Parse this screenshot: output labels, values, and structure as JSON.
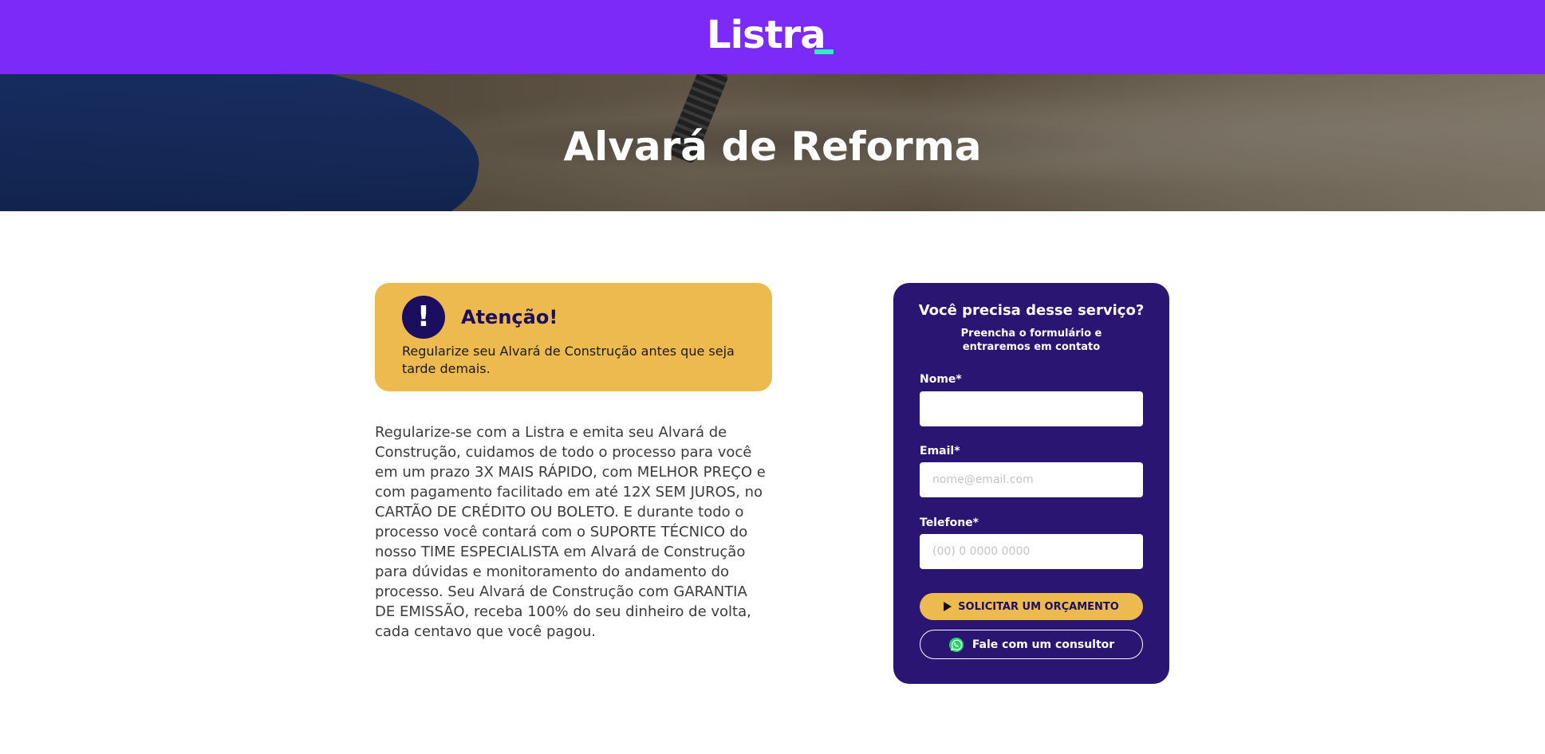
{
  "header": {
    "logo_text": "Listra",
    "brand_color": "#7b2af7",
    "accent_color": "#2ff0c2"
  },
  "hero": {
    "title": "Alvará de Reforma"
  },
  "alert": {
    "icon": "exclamation-icon",
    "title": "Atenção!",
    "text": "Regularize seu Alvará de Construção antes que seja tarde demais.",
    "background": "#ecba4f"
  },
  "description": "Regularize-se com a Listra e emita seu Alvará de Construção, cuidamos de todo o processo para você em um prazo 3X MAIS RÁPIDO, com MELHOR PREÇO e com pagamento facilitado em até 12X SEM JUROS, no CARTÃO DE CRÉDITO OU BOLETO. E durante todo o processo você contará com o SUPORTE TÉCNICO do nosso TIME ESPECIALISTA em Alvará de Construção para dúvidas e monitoramento do andamento do processo. Seu Alvará de Construção com GARANTIA DE EMISSÃO, receba 100% do seu dinheiro de volta, cada centavo que você pagou.",
  "form": {
    "title": "Você precisa desse serviço?",
    "subtitle": "Preencha o formulário e entraremos em contato",
    "background": "#2b1572",
    "fields": {
      "name": {
        "label": "Nome*",
        "value": "",
        "placeholder": ""
      },
      "email": {
        "label": "Email*",
        "value": "",
        "placeholder": "nome@email.com"
      },
      "phone": {
        "label": "Telefone*",
        "value": "",
        "placeholder": "(00) 0 0000 0000"
      }
    },
    "submit_label": "SOLICITAR UM ORÇAMENTO",
    "submit_icon": "play-icon",
    "consult_label": "Fale com um consultor",
    "consult_icon": "whatsapp-icon"
  }
}
